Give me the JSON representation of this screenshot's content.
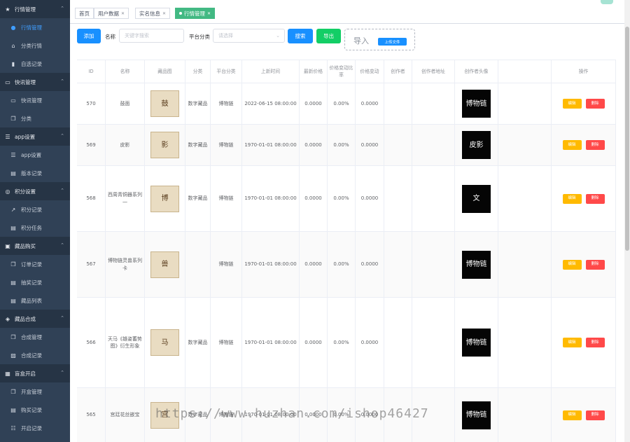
{
  "sidebar": {
    "groups": [
      {
        "label": "行情管理",
        "icon": "star-icon",
        "items": [
          {
            "label": "行情管理",
            "icon": "circle-icon",
            "active": true
          },
          {
            "label": "分类行情",
            "icon": "home-icon"
          },
          {
            "label": "自选记录",
            "icon": "bookmark-icon"
          }
        ]
      },
      {
        "label": "快讯管理",
        "icon": "monitor-icon",
        "items": [
          {
            "label": "快讯管理",
            "icon": "monitor-icon"
          },
          {
            "label": "分类",
            "icon": "copy-icon"
          }
        ]
      },
      {
        "label": "app设置",
        "icon": "sliders-icon",
        "items": [
          {
            "label": "app设置",
            "icon": "sliders-icon"
          },
          {
            "label": "版本记录",
            "icon": "file-icon"
          }
        ]
      },
      {
        "label": "积分设置",
        "icon": "coin-icon",
        "items": [
          {
            "label": "积分记录",
            "icon": "chart-icon"
          },
          {
            "label": "积分任务",
            "icon": "document-icon"
          }
        ]
      },
      {
        "label": "藏品购买",
        "icon": "box-icon",
        "items": [
          {
            "label": "订单记录",
            "icon": "copy-icon"
          },
          {
            "label": "抽奖记录",
            "icon": "document-icon"
          },
          {
            "label": "藏品列表",
            "icon": "document-icon"
          }
        ]
      },
      {
        "label": "藏品合成",
        "icon": "layers-icon",
        "items": [
          {
            "label": "合成管理",
            "icon": "copy-icon"
          },
          {
            "label": "合成记录",
            "icon": "image-icon"
          }
        ]
      },
      {
        "label": "盲盒开启",
        "icon": "grid-icon",
        "items": [
          {
            "label": "开盒管理",
            "icon": "copy-icon"
          },
          {
            "label": "购买记录",
            "icon": "document-icon"
          },
          {
            "label": "开启记录",
            "icon": "list-icon"
          }
        ]
      }
    ]
  },
  "tabs": [
    {
      "label": "首页",
      "closable": false
    },
    {
      "label": "用户数据",
      "closable": true
    },
    {
      "label": "实名信息",
      "closable": true
    },
    {
      "label": "行情管理",
      "closable": true,
      "active": true
    }
  ],
  "toolbar": {
    "add_label": "添加",
    "name_label": "名称",
    "name_placeholder": "关键字搜索",
    "platform_label": "平台分类",
    "platform_placeholder": "请选择",
    "search_label": "搜索",
    "export_label": "导出",
    "import_label": "导入",
    "upload_label": "上传文件"
  },
  "table": {
    "headers": [
      "ID",
      "名称",
      "藏品图",
      "分类",
      "平台分类",
      "上新时间",
      "最新价格",
      "价格变动比率",
      "价格变动",
      "创作者",
      "创作者地址",
      "创作者头像",
      "操作"
    ],
    "edit_label": "编辑",
    "delete_label": "删除",
    "rows": [
      {
        "id": "570",
        "name": "鼓面",
        "category": "数字藏品",
        "platform": "博物链",
        "time": "2022-06-15 08:00:00",
        "price": "0.0000",
        "ratio": "0.00%",
        "change": "0.0000",
        "creator": "",
        "address": "",
        "img_glyph": "鼓",
        "avatar_glyph": "博物链"
      },
      {
        "id": "569",
        "name": "皮影",
        "category": "数字藏品",
        "platform": "博物链",
        "time": "1970-01-01 08:00:00",
        "price": "0.0000",
        "ratio": "0.00%",
        "change": "0.0000",
        "creator": "",
        "address": "",
        "img_glyph": "影",
        "avatar_glyph": "皮影"
      },
      {
        "id": "568",
        "name": "西周青铜器系列一",
        "category": "数字藏品",
        "platform": "博物链",
        "time": "1970-01-01 08:00:00",
        "price": "0.0000",
        "ratio": "0.00%",
        "change": "0.0000",
        "creator": "",
        "address": "",
        "img_glyph": "博",
        "avatar_glyph": "文"
      },
      {
        "id": "567",
        "name": "博物链灵兽系列 卡",
        "category": "",
        "platform": "博物链",
        "time": "1970-01-01 08:00:00",
        "price": "0.0000",
        "ratio": "0.00%",
        "change": "0.0000",
        "creator": "",
        "address": "",
        "img_glyph": "兽",
        "avatar_glyph": "博物链"
      },
      {
        "id": "566",
        "name": "天马《雄姿蓄势图》衍生形象",
        "category": "数字藏品",
        "platform": "博物链",
        "time": "1970-01-01 08:00:00",
        "price": "0.0000",
        "ratio": "0.00%",
        "change": "0.0000",
        "creator": "",
        "address": "",
        "img_glyph": "马",
        "avatar_glyph": "博物链"
      },
      {
        "id": "565",
        "name": "宫廷花丝嵌宝",
        "category": "数字藏品",
        "platform": "博物链",
        "time": "1970-01-01 08:00:00",
        "price": "0.0000",
        "ratio": "0.00%",
        "change": "0.0000",
        "creator": "",
        "address": "",
        "img_glyph": "宫",
        "avatar_glyph": "博物链"
      }
    ]
  },
  "watermark": "https://www.huzhan.com/ishop46427"
}
